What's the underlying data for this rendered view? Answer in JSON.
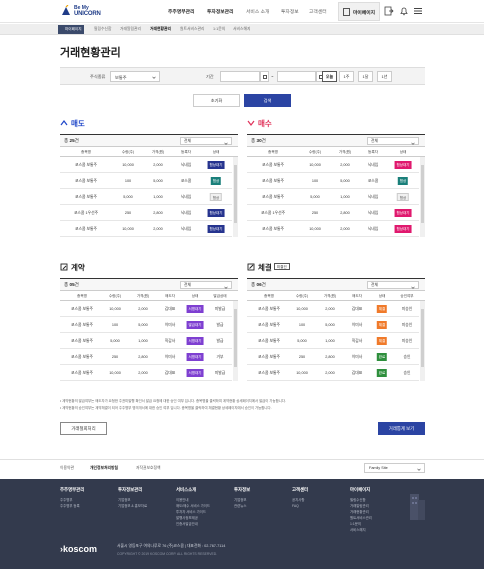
{
  "header": {
    "logo_line1": "Be My",
    "logo_line2": "UNICORN",
    "nav": [
      "주주명부관리",
      "투자정보관리",
      "서비스 소개",
      "투자정보",
      "고객센터"
    ],
    "mypage_label": "마이페이지",
    "icons": [
      "bell-icon",
      "upload-icon",
      "menu-icon"
    ]
  },
  "breadcrumb": {
    "home": "마이페이지",
    "items": [
      "필링수신함",
      "거래알림관리",
      "거래현황관리",
      "원트서비스관리",
      "1:1문의",
      "서비스해지"
    ],
    "active_index": 2
  },
  "page_title": "거래현황관리",
  "filter": {
    "stock_label": "주식종류",
    "stock_value": "보통주",
    "period_label": "기간",
    "date_sep": "~",
    "periods": [
      "오늘",
      "1주",
      "1달",
      "1년"
    ],
    "active_period": 0
  },
  "buttons": {
    "reset": "초기화",
    "search": "검색"
  },
  "sections": {
    "sell": {
      "title": "매도",
      "count_prefix": "총",
      "count": "25",
      "count_suffix": "건",
      "select": "전체",
      "color": "#1f47c9",
      "headers": [
        "종목명",
        "수량(주)",
        "가격(원)",
        "등록자",
        "상태"
      ],
      "rows": [
        [
          "코스콤 보통주",
          "10,000",
          "2,000",
          "닉네임",
          "협상대기",
          "#26348f"
        ],
        [
          "코스콤 보통주",
          "100",
          "5,000",
          "코스콤",
          "협상",
          "#1a7f7a"
        ],
        [
          "코스콤 보통주",
          "5,000",
          "1,000",
          "닉네임",
          "협상",
          "#f1f1f1"
        ],
        [
          "코스콤 1우선주",
          "250",
          "2,800",
          "닉네임",
          "협상대기",
          "#26348f"
        ],
        [
          "코스콤 보통주",
          "10,000",
          "2,000",
          "닉네임",
          "협상대기",
          "#26348f"
        ]
      ]
    },
    "buy": {
      "title": "매수",
      "count_prefix": "총",
      "count": "30",
      "count_suffix": "건",
      "select": "전체",
      "color": "#e0325a",
      "headers": [
        "종목명",
        "수량(주)",
        "가격(원)",
        "등록자",
        "상태"
      ],
      "rows": [
        [
          "코스콤 보통주",
          "10,000",
          "2,000",
          "닉네임",
          "협상대기",
          "#e0196e"
        ],
        [
          "코스콤 보통주",
          "100",
          "5,000",
          "코스콤",
          "협상",
          "#1a7f7a"
        ],
        [
          "코스콤 보통주",
          "5,000",
          "1,000",
          "닉네임",
          "협상",
          "#f1f1f1"
        ],
        [
          "코스콤 1우선주",
          "250",
          "2,800",
          "닉네임",
          "협상대기",
          "#e0196e"
        ],
        [
          "코스콤 보통주",
          "10,000",
          "2,000",
          "닉네임",
          "협상대기",
          "#e0196e"
        ]
      ]
    },
    "contract": {
      "title": "계약",
      "count_prefix": "총",
      "count": "05",
      "count_suffix": "건",
      "select": "전체",
      "color": "#222",
      "headers": [
        "종목명",
        "수량(주)",
        "가격(원)",
        "매도자",
        "상태",
        "발급상태"
      ],
      "rows": [
        [
          "코스콤 보통주",
          "10,000",
          "2,000",
          "김대표",
          "서명대기",
          "미발급",
          "#7e3fd1"
        ],
        [
          "코스콤 보통주",
          "100",
          "5,000",
          "이미사",
          "발급대기",
          "발급",
          "#7e3fd1"
        ],
        [
          "코스콤 보통주",
          "5,000",
          "1,000",
          "직감사",
          "서명대기",
          "발급",
          "#7e3fd1"
        ],
        [
          "코스콤 보통주",
          "250",
          "2,800",
          "이미사",
          "서명대기",
          "거부",
          "#7e3fd1"
        ],
        [
          "코스콤 보통주",
          "10,000",
          "2,000",
          "김대표",
          "서명대기",
          "미발급",
          "#7e3fd1"
        ]
      ]
    },
    "settle": {
      "title": "체결",
      "count_prefix": "총",
      "count": "06",
      "count_suffix": "건",
      "extra_button": "미결건",
      "select": "전체",
      "color": "#222",
      "headers": [
        "종목명",
        "수량(주)",
        "가격(원)",
        "매도자",
        "상태",
        "승인여부"
      ],
      "rows": [
        [
          "코스콤 보통주",
          "10,000",
          "2,000",
          "김대표",
          "체결",
          "미승인",
          "#f07a2a"
        ],
        [
          "코스콤 보통주",
          "100",
          "5,000",
          "이미사",
          "체결",
          "미승인",
          "#f07a2a"
        ],
        [
          "코스콤 보통주",
          "5,000",
          "1,000",
          "직감사",
          "체결",
          "미승인",
          "#f07a2a"
        ],
        [
          "코스콤 보통주",
          "250",
          "2,800",
          "이미사",
          "완료",
          "승인",
          "#2e8f3d"
        ],
        [
          "코스콤 보통주",
          "10,000",
          "2,000",
          "김대표",
          "완료",
          "승인",
          "#2e8f3d"
        ]
      ]
    }
  },
  "notes": [
    "• 계약현황의 발급여부는 매도자가 요청한 주권미발행 확인서 발급 요청에 대한 승인 여부 입니다. 종목명을 클릭하여 계약현황 상세페이지에서 발급이 가능합니다.",
    "• 계약현황의 승인여부는 계약체결이 되어 주주명부 명의개서에 대한 승인 여부 입니다. 종목명을 클릭하여 체결현황 상세페이지에서 승인이 가능합니다."
  ],
  "bottom_buttons": {
    "cancel": "거래철회처리",
    "view": "거래통계 보기"
  },
  "footer": {
    "links": [
      "이용약관",
      "개인정보처리방침",
      "저작권보호정책"
    ],
    "family_site": "Family Site",
    "columns": [
      {
        "h": "주주명부관리",
        "l": [
          "주주명부",
          "주주명부 등록"
        ]
      },
      {
        "h": "투자정보관리",
        "l": [
          "기업정보",
          "기업정보 & 홍보자료"
        ]
      },
      {
        "h": "서비스소개",
        "l": [
          "이용안내",
          "매도/매수 서비스 가이드",
          "투자자 서비스 가이드",
          "발행사정보제공",
          "인증서발급안내"
        ]
      },
      {
        "h": "투자정보",
        "l": [
          "기업정보",
          "관련뉴스"
        ]
      },
      {
        "h": "고객센터",
        "l": [
          "공지사항",
          "FAQ"
        ]
      },
      {
        "h": "마이페이지",
        "l": [
          "필링수신함",
          "거래알림관리",
          "거래현황관리",
          "원트서비스관리",
          "1:1문의",
          "서비스해지"
        ]
      }
    ],
    "brand": "›koscom",
    "address": "서울시 영등포구 여의나루로 76 (주)코스콤   |   대표전화 : 02-767-7114",
    "copyright": "COPYRIGHT © 2019 KOSCOM CORP. ALL RIGHTS RESERVED."
  }
}
